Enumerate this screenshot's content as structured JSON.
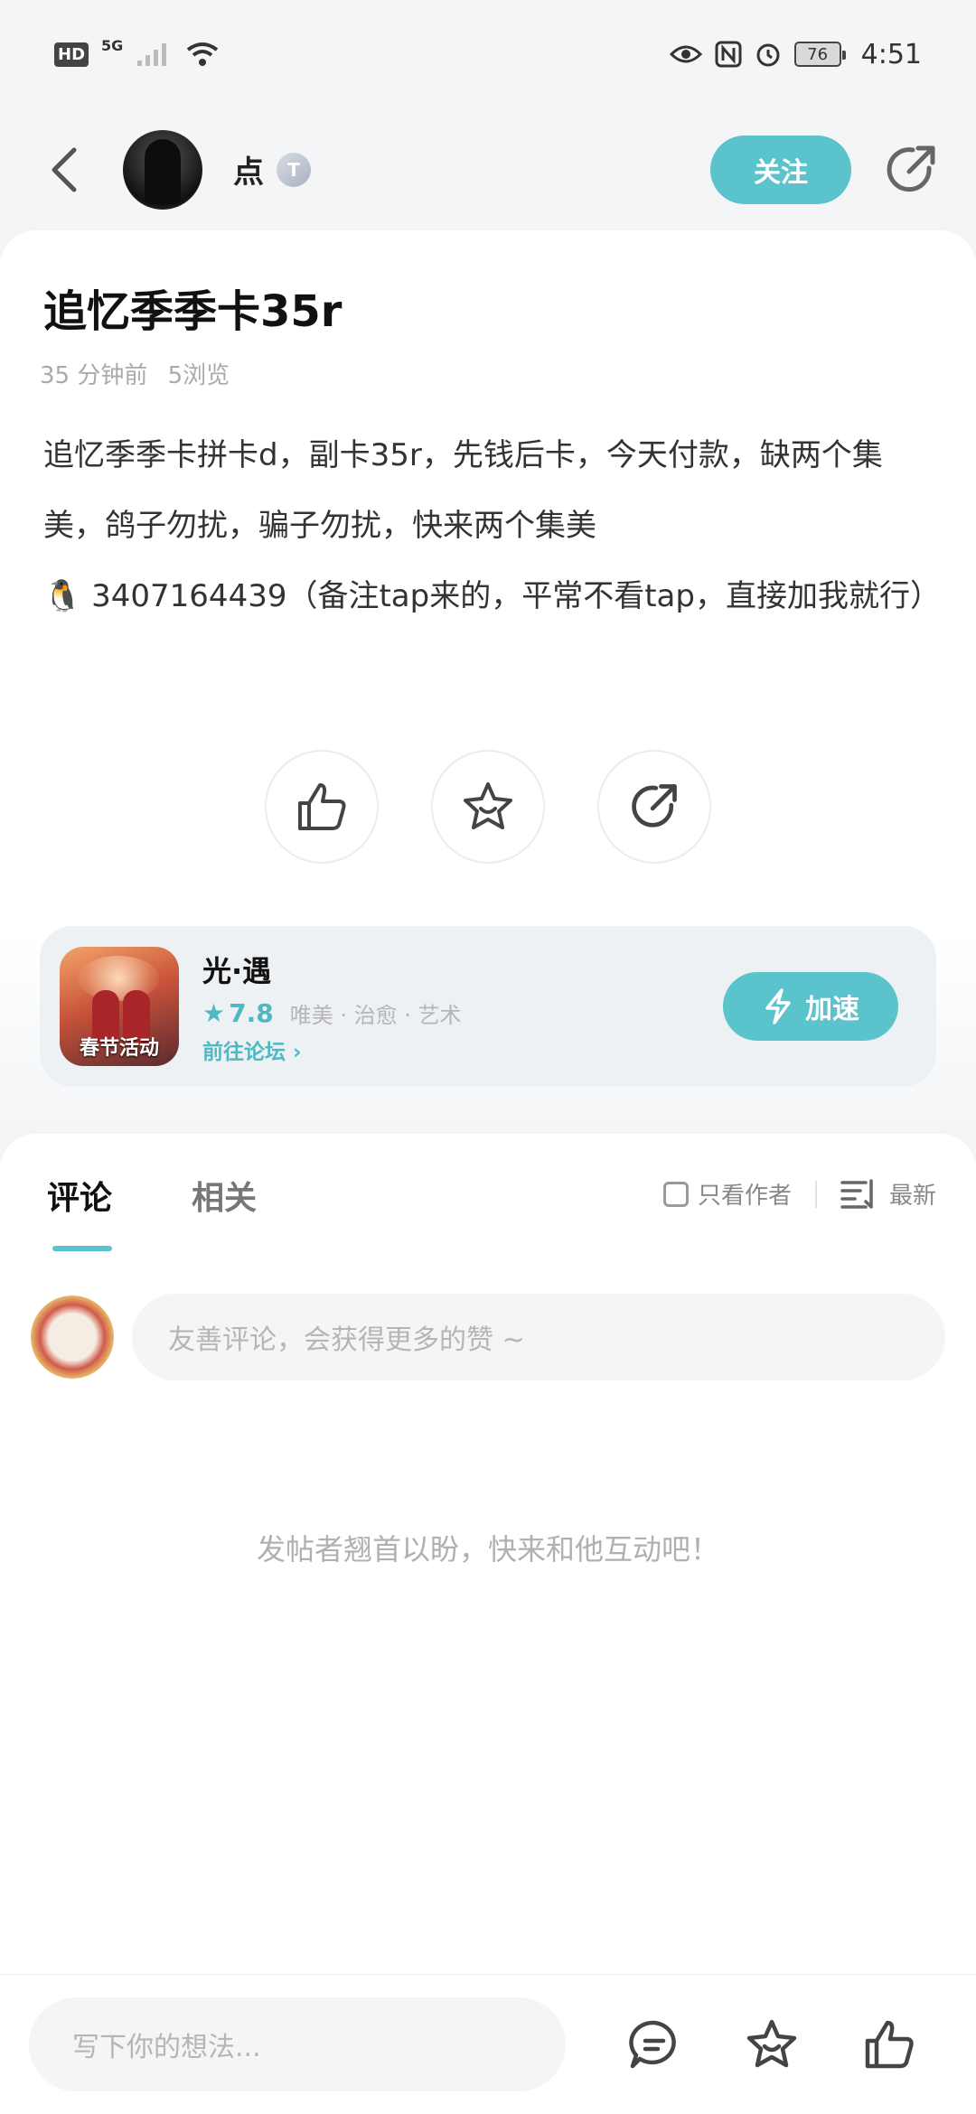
{
  "status_bar": {
    "hd": "HD",
    "network": "5G",
    "battery": "76",
    "time": "4:51"
  },
  "header": {
    "username": "点",
    "level_badge": "T",
    "follow_label": "关注"
  },
  "post": {
    "title": "追忆季季卡35r",
    "time_ago": "35 分钟前",
    "views": "5浏览",
    "body_line1": "追忆季季卡拼卡d，副卡35r，先钱后卡，今天付款，缺两个集美，鸽子勿扰，骗子勿扰，快来两个集美",
    "body_line2": "🐧 3407164439（备注tap来的，平常不看tap，直接加我就行）"
  },
  "game": {
    "name": "光·遇",
    "rating": "7.8",
    "tags": "唯美 · 治愈 · 艺术",
    "forum_link": "前往论坛",
    "icon_tag": "春节活动",
    "speedup_label": "加速"
  },
  "comments": {
    "tab_comments": "评论",
    "tab_related": "相关",
    "only_author": "只看作者",
    "sort_label": "最新",
    "input_placeholder": "友善评论，会获得更多的赞 ~",
    "empty_hint": "发帖者翘首以盼，快来和他互动吧！"
  },
  "bottom_bar": {
    "input_placeholder": "写下你的想法..."
  },
  "colors": {
    "accent": "#5ac3cc",
    "background": "#f3f5f7"
  }
}
